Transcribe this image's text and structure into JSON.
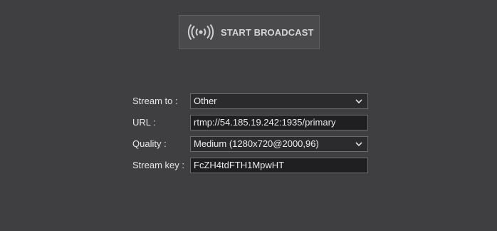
{
  "broadcast": {
    "label": "START BROADCAST",
    "icon": "broadcast-icon"
  },
  "form": {
    "stream_to": {
      "label": "Stream to :",
      "value": "Other"
    },
    "url": {
      "label": "URL :",
      "value": "rtmp://54.185.19.242:1935/primary"
    },
    "quality": {
      "label": "Quality :",
      "value": "Medium (1280x720@2000,96)"
    },
    "stream_key": {
      "label": "Stream key :",
      "value": "FcZH4tdFTH1MpwHT"
    }
  },
  "colors": {
    "background": "#3f3f42",
    "field_background": "#1f1f21",
    "field_border": "#6b6b6e"
  }
}
